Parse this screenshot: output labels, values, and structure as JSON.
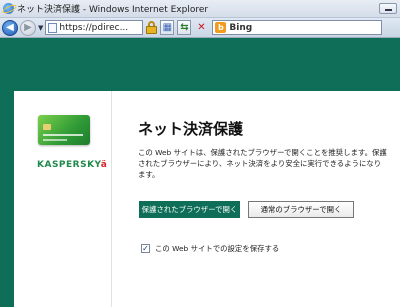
{
  "window": {
    "title": "ネット決済保護 - Windows Internet Explorer"
  },
  "navbar": {
    "address_text": "https://pdirec...",
    "search_text": "Bing",
    "icons": [
      "back-icon",
      "forward-icon",
      "page-icon",
      "lock-icon",
      "compatibility-icon",
      "refresh-icon",
      "stop-icon",
      "bing-icon"
    ]
  },
  "dialog": {
    "logo_text": "KASPERSKY",
    "logo_mark": "ä",
    "heading": "ネット決済保護",
    "description": "この Web サイトは、保護されたブラウザーで開くことを推奨します。保護されたブラウザーにより、ネット決済をより安全に実行できるようになります。",
    "primary_button": "保護されたブラウザーで開く",
    "secondary_button": "通常のブラウザーで開く",
    "remember_label": "この Web サイトでの設定を保存する",
    "remember_checked": true
  },
  "colors": {
    "brand_green": "#0e6e58",
    "dialog_background": "#ffffff"
  }
}
